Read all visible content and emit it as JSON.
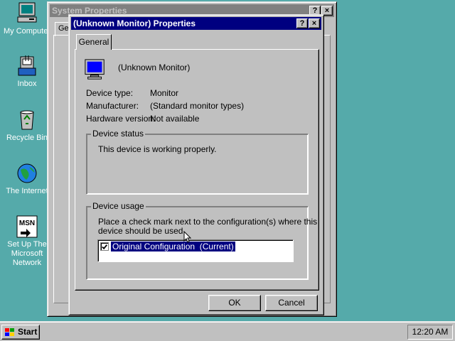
{
  "desktop": {
    "icons": [
      {
        "label": "My Computer",
        "icon": "my-computer-icon"
      },
      {
        "label": "Inbox",
        "icon": "inbox-icon"
      },
      {
        "label": "Recycle Bin",
        "icon": "recycle-bin-icon"
      },
      {
        "label": "The Internet",
        "icon": "internet-icon"
      },
      {
        "label": "Set Up The Microsoft Network",
        "icon": "msn-setup-icon"
      }
    ]
  },
  "background_window": {
    "title": "System Properties",
    "tab_partial": "Ge",
    "help_label": "?",
    "close_label": "×"
  },
  "dialog": {
    "title": "(Unknown Monitor) Properties",
    "help_label": "?",
    "close_label": "×",
    "tab": "General",
    "device_name": "(Unknown Monitor)",
    "device_type_label": "Device type:",
    "device_type_value": "Monitor",
    "manufacturer_label": "Manufacturer:",
    "manufacturer_value": "(Standard monitor types)",
    "hardware_version_label": "Hardware version:",
    "hardware_version_value": "Not available",
    "status_group_label": "Device status",
    "status_text": "This device is working properly.",
    "usage_group_label": "Device usage",
    "usage_text_line1": "Place a check mark next to the configuration(s) where this",
    "usage_text_line2": "device should be used.",
    "config_item": "Original Configuration  (Current)",
    "config_checked": true,
    "ok_label": "OK",
    "cancel_label": "Cancel"
  },
  "taskbar": {
    "start_label": "Start",
    "clock": "12:20 AM"
  },
  "colors": {
    "desktop": "#55aaaa",
    "title_active": "#000080",
    "title_inactive": "#808080",
    "face": "#c0c0c0"
  }
}
